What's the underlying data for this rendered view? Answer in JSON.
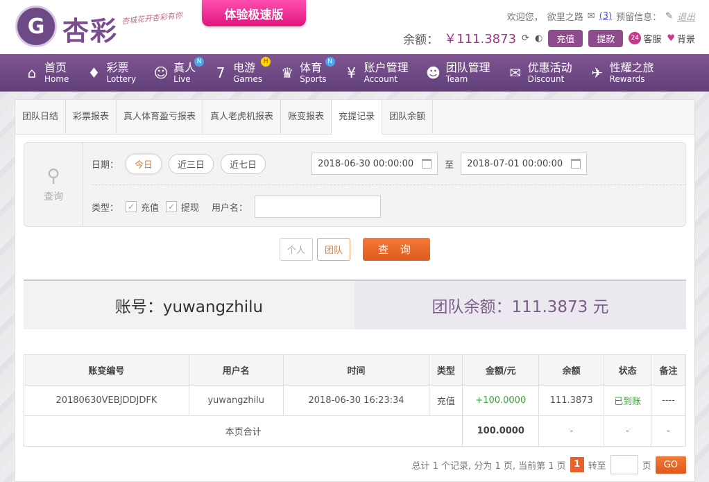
{
  "header": {
    "logo_glyph": "G",
    "logo_text": "杏彩",
    "slogan": "杏城花开杏彩有你",
    "fast_label": "体验极速版",
    "welcome": "欢迎您，",
    "username": "欲里之路",
    "mail_count": "(3)",
    "notice_label": "预留信息：",
    "logout": "退出",
    "balance_label": "余额：",
    "balance_value": "￥111.3873",
    "deposit": "充值",
    "withdraw": "提款",
    "service": "客服",
    "background": "背景"
  },
  "nav": [
    {
      "zh": "首页",
      "en": "Home",
      "icon": "home-icon",
      "glyph": "⌂",
      "badge": ""
    },
    {
      "zh": "彩票",
      "en": "Lottery",
      "icon": "lottery-icon",
      "glyph": "♦",
      "badge": ""
    },
    {
      "zh": "真人",
      "en": "Live",
      "icon": "live-icon",
      "glyph": "☺",
      "badge": "N"
    },
    {
      "zh": "电游",
      "en": "Games",
      "icon": "games-icon",
      "glyph": "7",
      "badge": "H"
    },
    {
      "zh": "体育",
      "en": "Sports",
      "icon": "sports-icon",
      "glyph": "♛",
      "badge": "N"
    },
    {
      "zh": "账户管理",
      "en": "Account",
      "icon": "account-icon",
      "glyph": "¥",
      "badge": ""
    },
    {
      "zh": "团队管理",
      "en": "Team",
      "icon": "team-icon",
      "glyph": "☻",
      "badge": ""
    },
    {
      "zh": "优惠活动",
      "en": "Discount",
      "icon": "gift-icon",
      "glyph": "✉",
      "badge": ""
    },
    {
      "zh": "性耀之旅",
      "en": "Rewards",
      "icon": "rewards-icon",
      "glyph": "✈",
      "badge": ""
    }
  ],
  "tabs": [
    "团队日结",
    "彩票报表",
    "真人体育盈亏报表",
    "真人老虎机报表",
    "账变报表",
    "充提记录",
    "团队余额"
  ],
  "search": {
    "label": "查询",
    "date_label": "日期：",
    "today": "今日",
    "three_days": "近三日",
    "seven_days": "近七日",
    "start": "2018-06-30 00:00:00",
    "to": "至",
    "end": "2018-07-01 00:00:00",
    "type_label": "类型：",
    "deposit": "充值",
    "withdraw": "提现",
    "user_label": "用户名："
  },
  "buttons": {
    "personal": "个人",
    "team": "团队",
    "query": "查 询"
  },
  "info": {
    "account": "账号：yuwangzhilu",
    "team_balance": "团队余额：111.3873 元"
  },
  "table": {
    "headers": [
      "账变编号",
      "用户名",
      "时间",
      "类型",
      "金额/元",
      "余额",
      "状态",
      "备注"
    ],
    "row": [
      "20180630VEBJDDJDFK",
      "yuwangzhilu",
      "2018-06-30 16:23:34",
      "充值",
      "+100.0000",
      "111.3873",
      "已到账",
      "----"
    ],
    "total_label": "本页合计",
    "total_amount": "100.0000",
    "total_balance": "-",
    "total_status": "-",
    "total_note": "-"
  },
  "pager": {
    "summary": "总计 1 个记录, 分为 1 页, 当前第 1 页",
    "current": "1",
    "jump": "转至",
    "page": "页",
    "go": "GO"
  }
}
